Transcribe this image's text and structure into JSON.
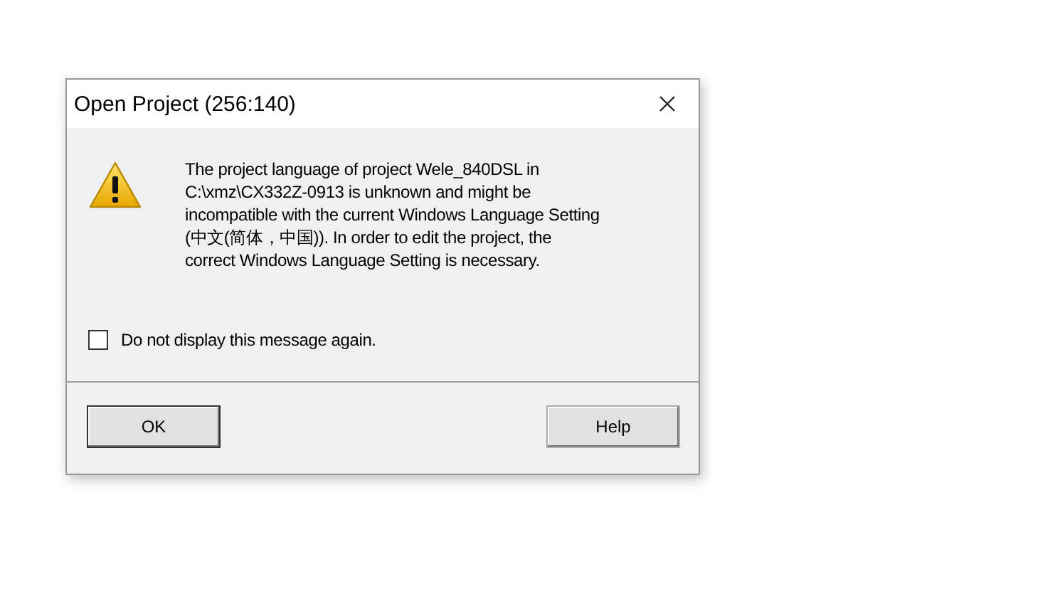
{
  "window": {
    "title": "Open Project (256:140)"
  },
  "message": "The project language of project Wele_840DSL in\nC:\\xmz\\CX332Z-0913 is unknown and might be\nincompatible with the current Windows Language Setting\n(中文(简体，中国)). In order to edit the project, the\ncorrect Windows Language Setting is necessary.",
  "checkbox": {
    "label": "Do not display this message again.",
    "checked": false
  },
  "buttons": [
    {
      "label": "OK",
      "kind": "default"
    },
    {
      "label": "Help",
      "kind": "normal"
    }
  ]
}
